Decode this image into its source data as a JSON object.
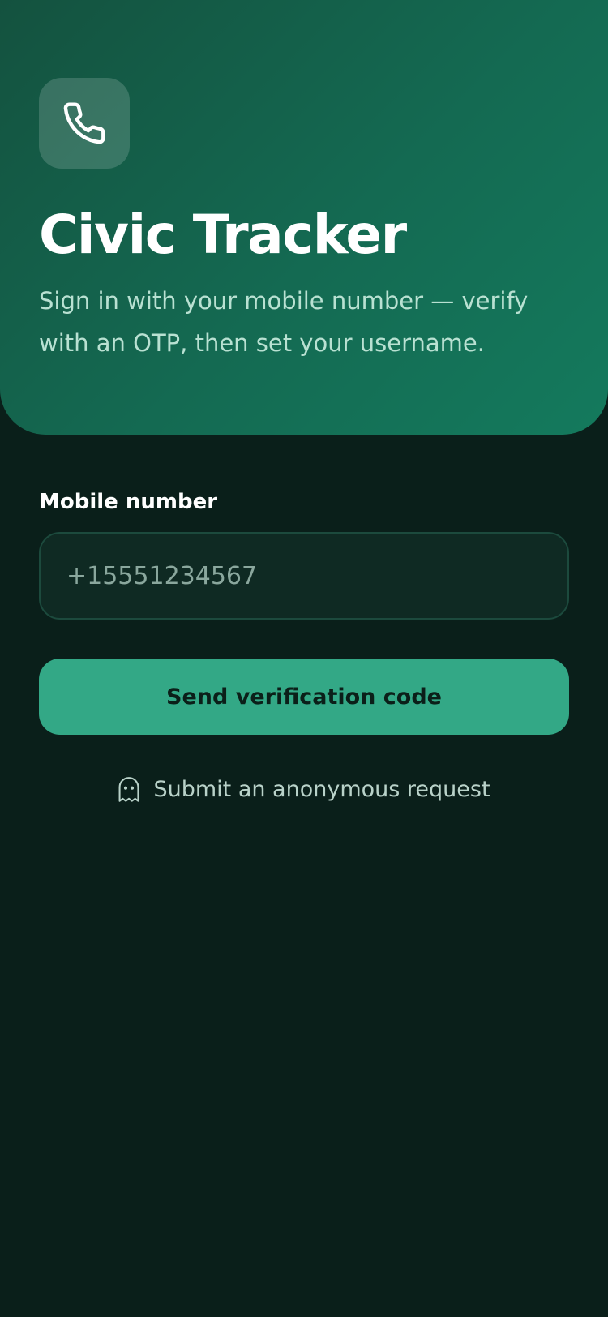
{
  "header": {
    "app_icon": "phone-icon",
    "title": "Civic Tracker",
    "subtitle": "Sign in with your mobile number — verify with an OTP, then set your username."
  },
  "form": {
    "mobile_label": "Mobile number",
    "mobile_placeholder": "+15551234567",
    "mobile_value": "",
    "send_button_label": "Send verification code",
    "anonymous_icon": "ghost-icon",
    "anonymous_link_label": "Submit an anonymous request"
  },
  "colors": {
    "background": "#0a1f1a",
    "hero_gradient_start": "#14523f",
    "hero_gradient_end": "#147a5d",
    "accent": "#33a886",
    "input_background": "#0f2a23",
    "input_border": "#1c4a3d"
  }
}
